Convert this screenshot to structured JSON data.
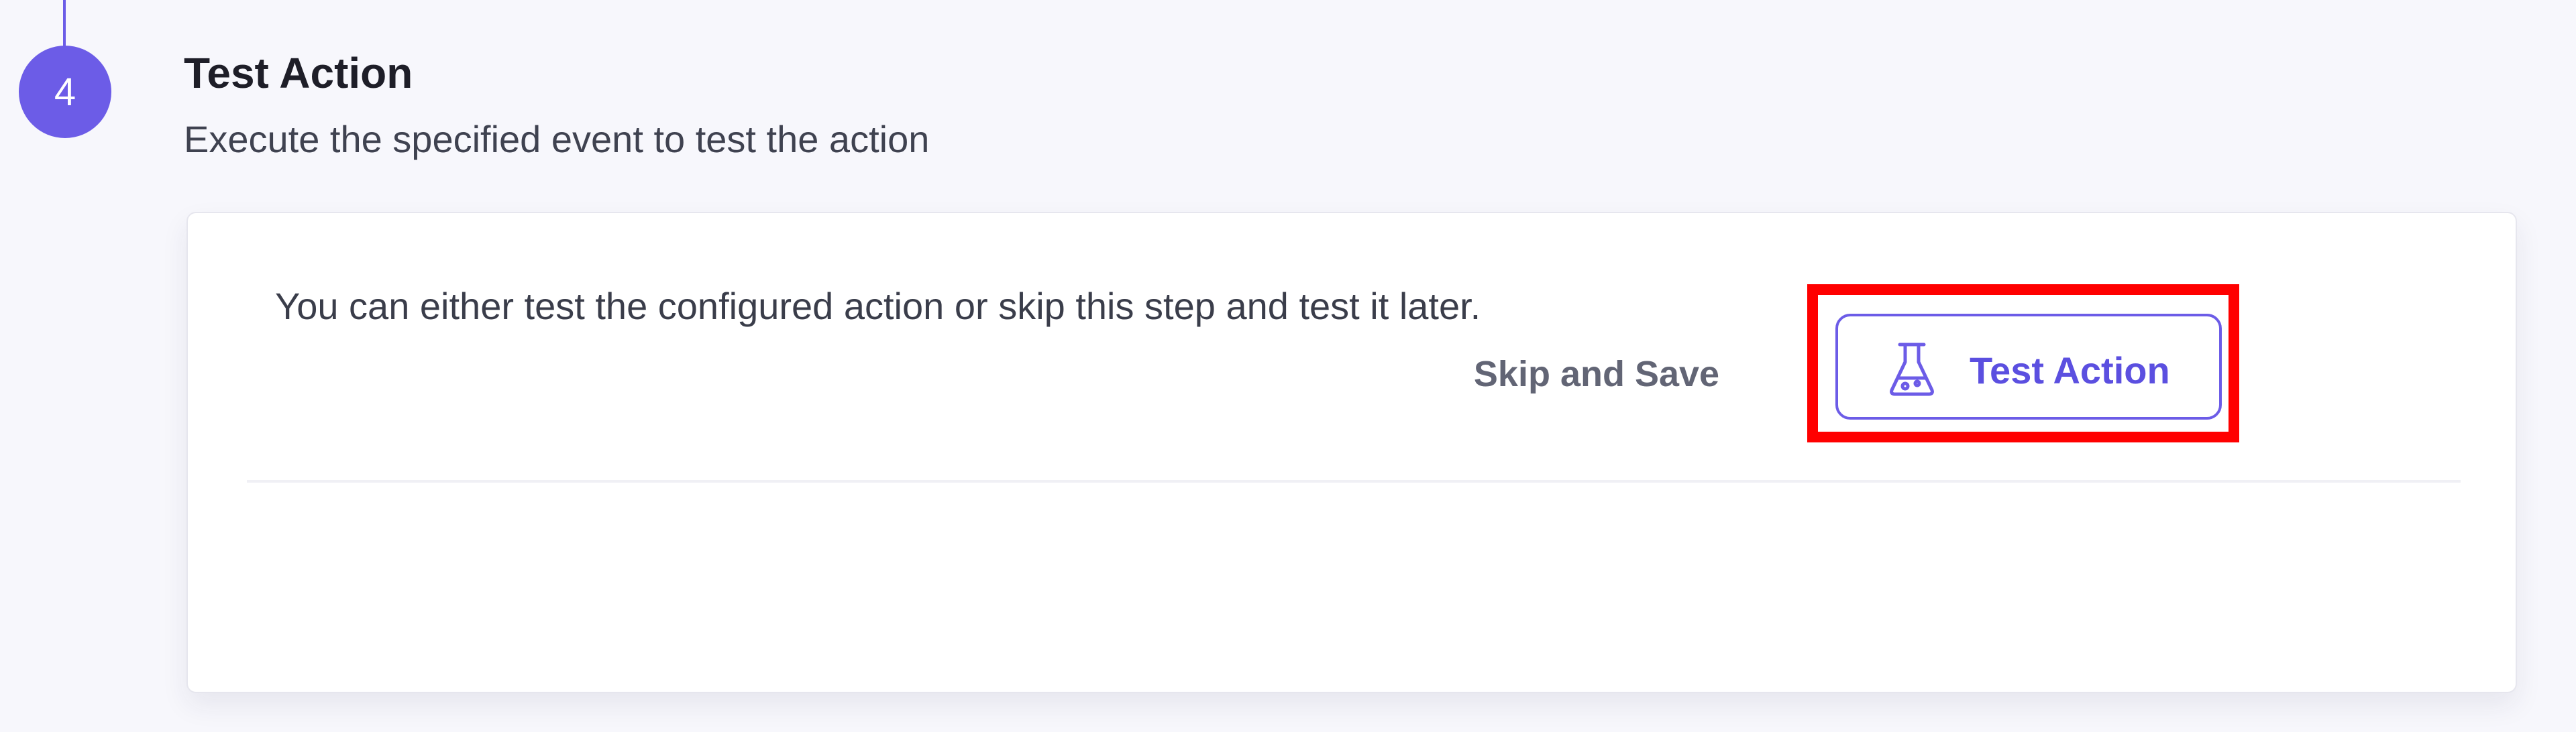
{
  "step": {
    "number": "4",
    "title": "Test Action",
    "subtitle": "Execute the specified event to test the action"
  },
  "card": {
    "message": "You can either test the configured action or skip this step and test it later.",
    "skip_label": "Skip and Save",
    "test_label": "Test Action",
    "test_icon": "flask-icon"
  },
  "colors": {
    "accent": "#6c5ce7",
    "highlight": "#ff0000",
    "background": "#f7f7fc"
  }
}
